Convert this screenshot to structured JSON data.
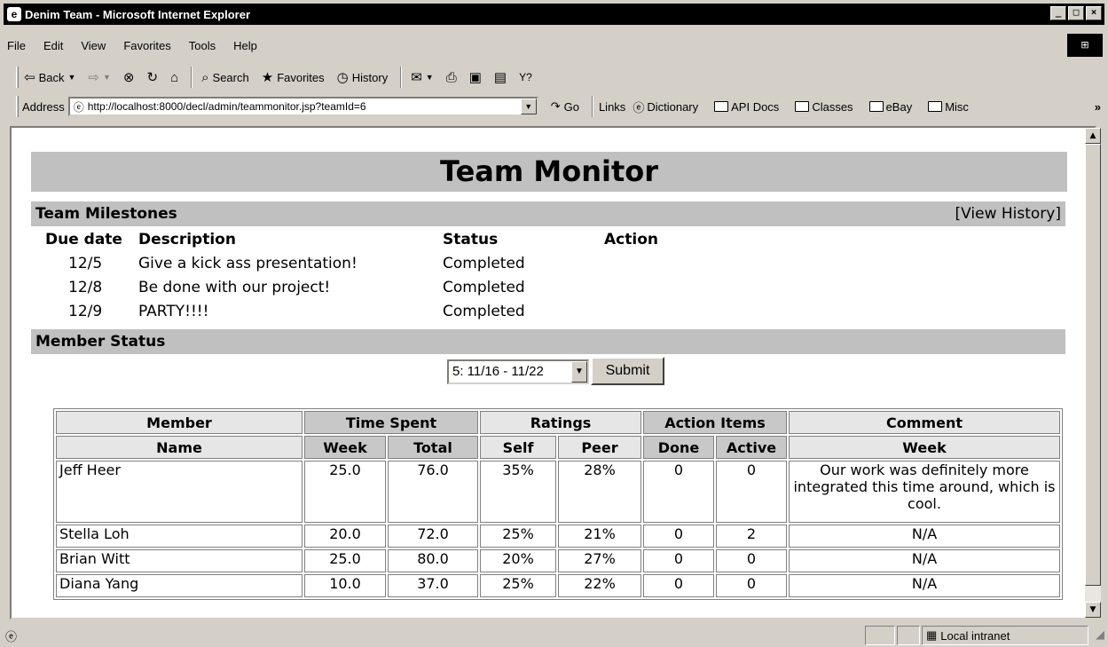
{
  "window": {
    "title": "Denim Team - Microsoft Internet Explorer",
    "icon": "ie-icon"
  },
  "menu": [
    "File",
    "Edit",
    "View",
    "Favorites",
    "Tools",
    "Help"
  ],
  "toolbar": {
    "back": "Back",
    "search": "Search",
    "favorites": "Favorites",
    "history": "History"
  },
  "address": {
    "label": "Address",
    "url": "http://localhost:8000/decl/admin/teammonitor.jsp?teamId=6",
    "go": "Go",
    "links_label": "Links",
    "links": [
      "Dictionary",
      "API Docs",
      "Classes",
      "eBay",
      "Misc"
    ]
  },
  "page": {
    "title": "Team Monitor",
    "milestones": {
      "heading": "Team Milestones",
      "view_history": "[View History]",
      "headers": [
        "Due date",
        "Description",
        "Status",
        "Action"
      ],
      "rows": [
        {
          "date": "12/5",
          "desc": "Give a kick ass presentation!",
          "status": "Completed"
        },
        {
          "date": "12/8",
          "desc": "Be done with our project!",
          "status": "Completed"
        },
        {
          "date": "12/9",
          "desc": "PARTY!!!!",
          "status": "Completed"
        }
      ]
    },
    "member_status": {
      "heading": "Member Status",
      "week_select": "5: 11/16 - 11/22",
      "submit": "Submit",
      "group_headers": [
        "Member",
        "Time Spent",
        "Ratings",
        "Action Items",
        "Comment"
      ],
      "sub_headers": [
        "Name",
        "Week",
        "Total",
        "Self",
        "Peer",
        "Done",
        "Active",
        "Week"
      ],
      "rows": [
        {
          "name": "Jeff Heer",
          "week": "25.0",
          "total": "76.0",
          "self": "35%",
          "peer": "28%",
          "done": "0",
          "active": "0",
          "comment": "Our work was definitely more integrated this time around, which is cool."
        },
        {
          "name": "Stella Loh",
          "week": "20.0",
          "total": "72.0",
          "self": "25%",
          "peer": "21%",
          "done": "0",
          "active": "2",
          "comment": "N/A"
        },
        {
          "name": "Brian Witt",
          "week": "25.0",
          "total": "80.0",
          "self": "20%",
          "peer": "27%",
          "done": "0",
          "active": "0",
          "comment": "N/A"
        },
        {
          "name": "Diana Yang",
          "week": "10.0",
          "total": "37.0",
          "self": "25%",
          "peer": "22%",
          "done": "0",
          "active": "0",
          "comment": "N/A"
        }
      ]
    }
  },
  "statusbar": {
    "zone": "Local intranet"
  }
}
